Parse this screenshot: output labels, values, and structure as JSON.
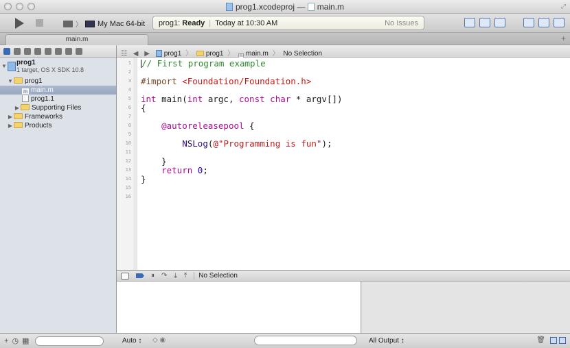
{
  "window": {
    "title_project": "prog1.xcodeproj",
    "title_separator": "—",
    "title_file": "main.m"
  },
  "toolbar": {
    "scheme_target": "My Mac 64-bit",
    "activity_project": "prog1:",
    "activity_status": "Ready",
    "activity_time": "Today at 10:30 AM",
    "activity_issues": "No Issues"
  },
  "tab": {
    "label": "main.m",
    "add_label": "+"
  },
  "navigator": {
    "project_name": "prog1",
    "project_subtitle": "1 target, OS X SDK 10.8",
    "items": [
      {
        "label": "prog1",
        "kind": "group"
      },
      {
        "label": "main.m",
        "kind": "file-m",
        "selected": true
      },
      {
        "label": "prog1.1",
        "kind": "file"
      },
      {
        "label": "Supporting Files",
        "kind": "group"
      },
      {
        "label": "Frameworks",
        "kind": "group"
      },
      {
        "label": "Products",
        "kind": "group"
      }
    ]
  },
  "jumpbar": {
    "crumbs": [
      "prog1",
      "prog1",
      "main.m",
      "No Selection"
    ]
  },
  "editor": {
    "line_numbers": [
      "1",
      "2",
      "3",
      "4",
      "5",
      "6",
      "7",
      "8",
      "9",
      "10",
      "11",
      "12",
      "13",
      "14",
      "15",
      "16"
    ],
    "lines": {
      "l1": "// First program example",
      "l3_directive": "#import ",
      "l3_header": "<Foundation/Foundation.h>",
      "l5_int": "int",
      "l5_main": " main(",
      "l5_int2": "int",
      "l5_argc": " argc, ",
      "l5_const": "const",
      "l5_sp": " ",
      "l5_char": "char",
      "l5_rest": " * argv[])",
      "l6": "{",
      "l8_kw": "@autoreleasepool",
      "l8_rest": " {",
      "l10_func": "NSLog",
      "l10_open": "(",
      "l10_str": "@\"Programming is fun\"",
      "l10_close": ");",
      "l12": "}",
      "l13_kw": "return",
      "l13_sp": " ",
      "l13_num": "0",
      "l13_semi": ";",
      "l14": "}"
    }
  },
  "debug": {
    "selection": "No Selection",
    "variables_scope": "Auto ↕",
    "output_scope": "All Output ↕"
  },
  "colors": {
    "comment": "#2f8a2f",
    "keyword": "#aa0d91",
    "string": "#c41a16",
    "number": "#1c00cf",
    "selection": "#97a8c1"
  }
}
